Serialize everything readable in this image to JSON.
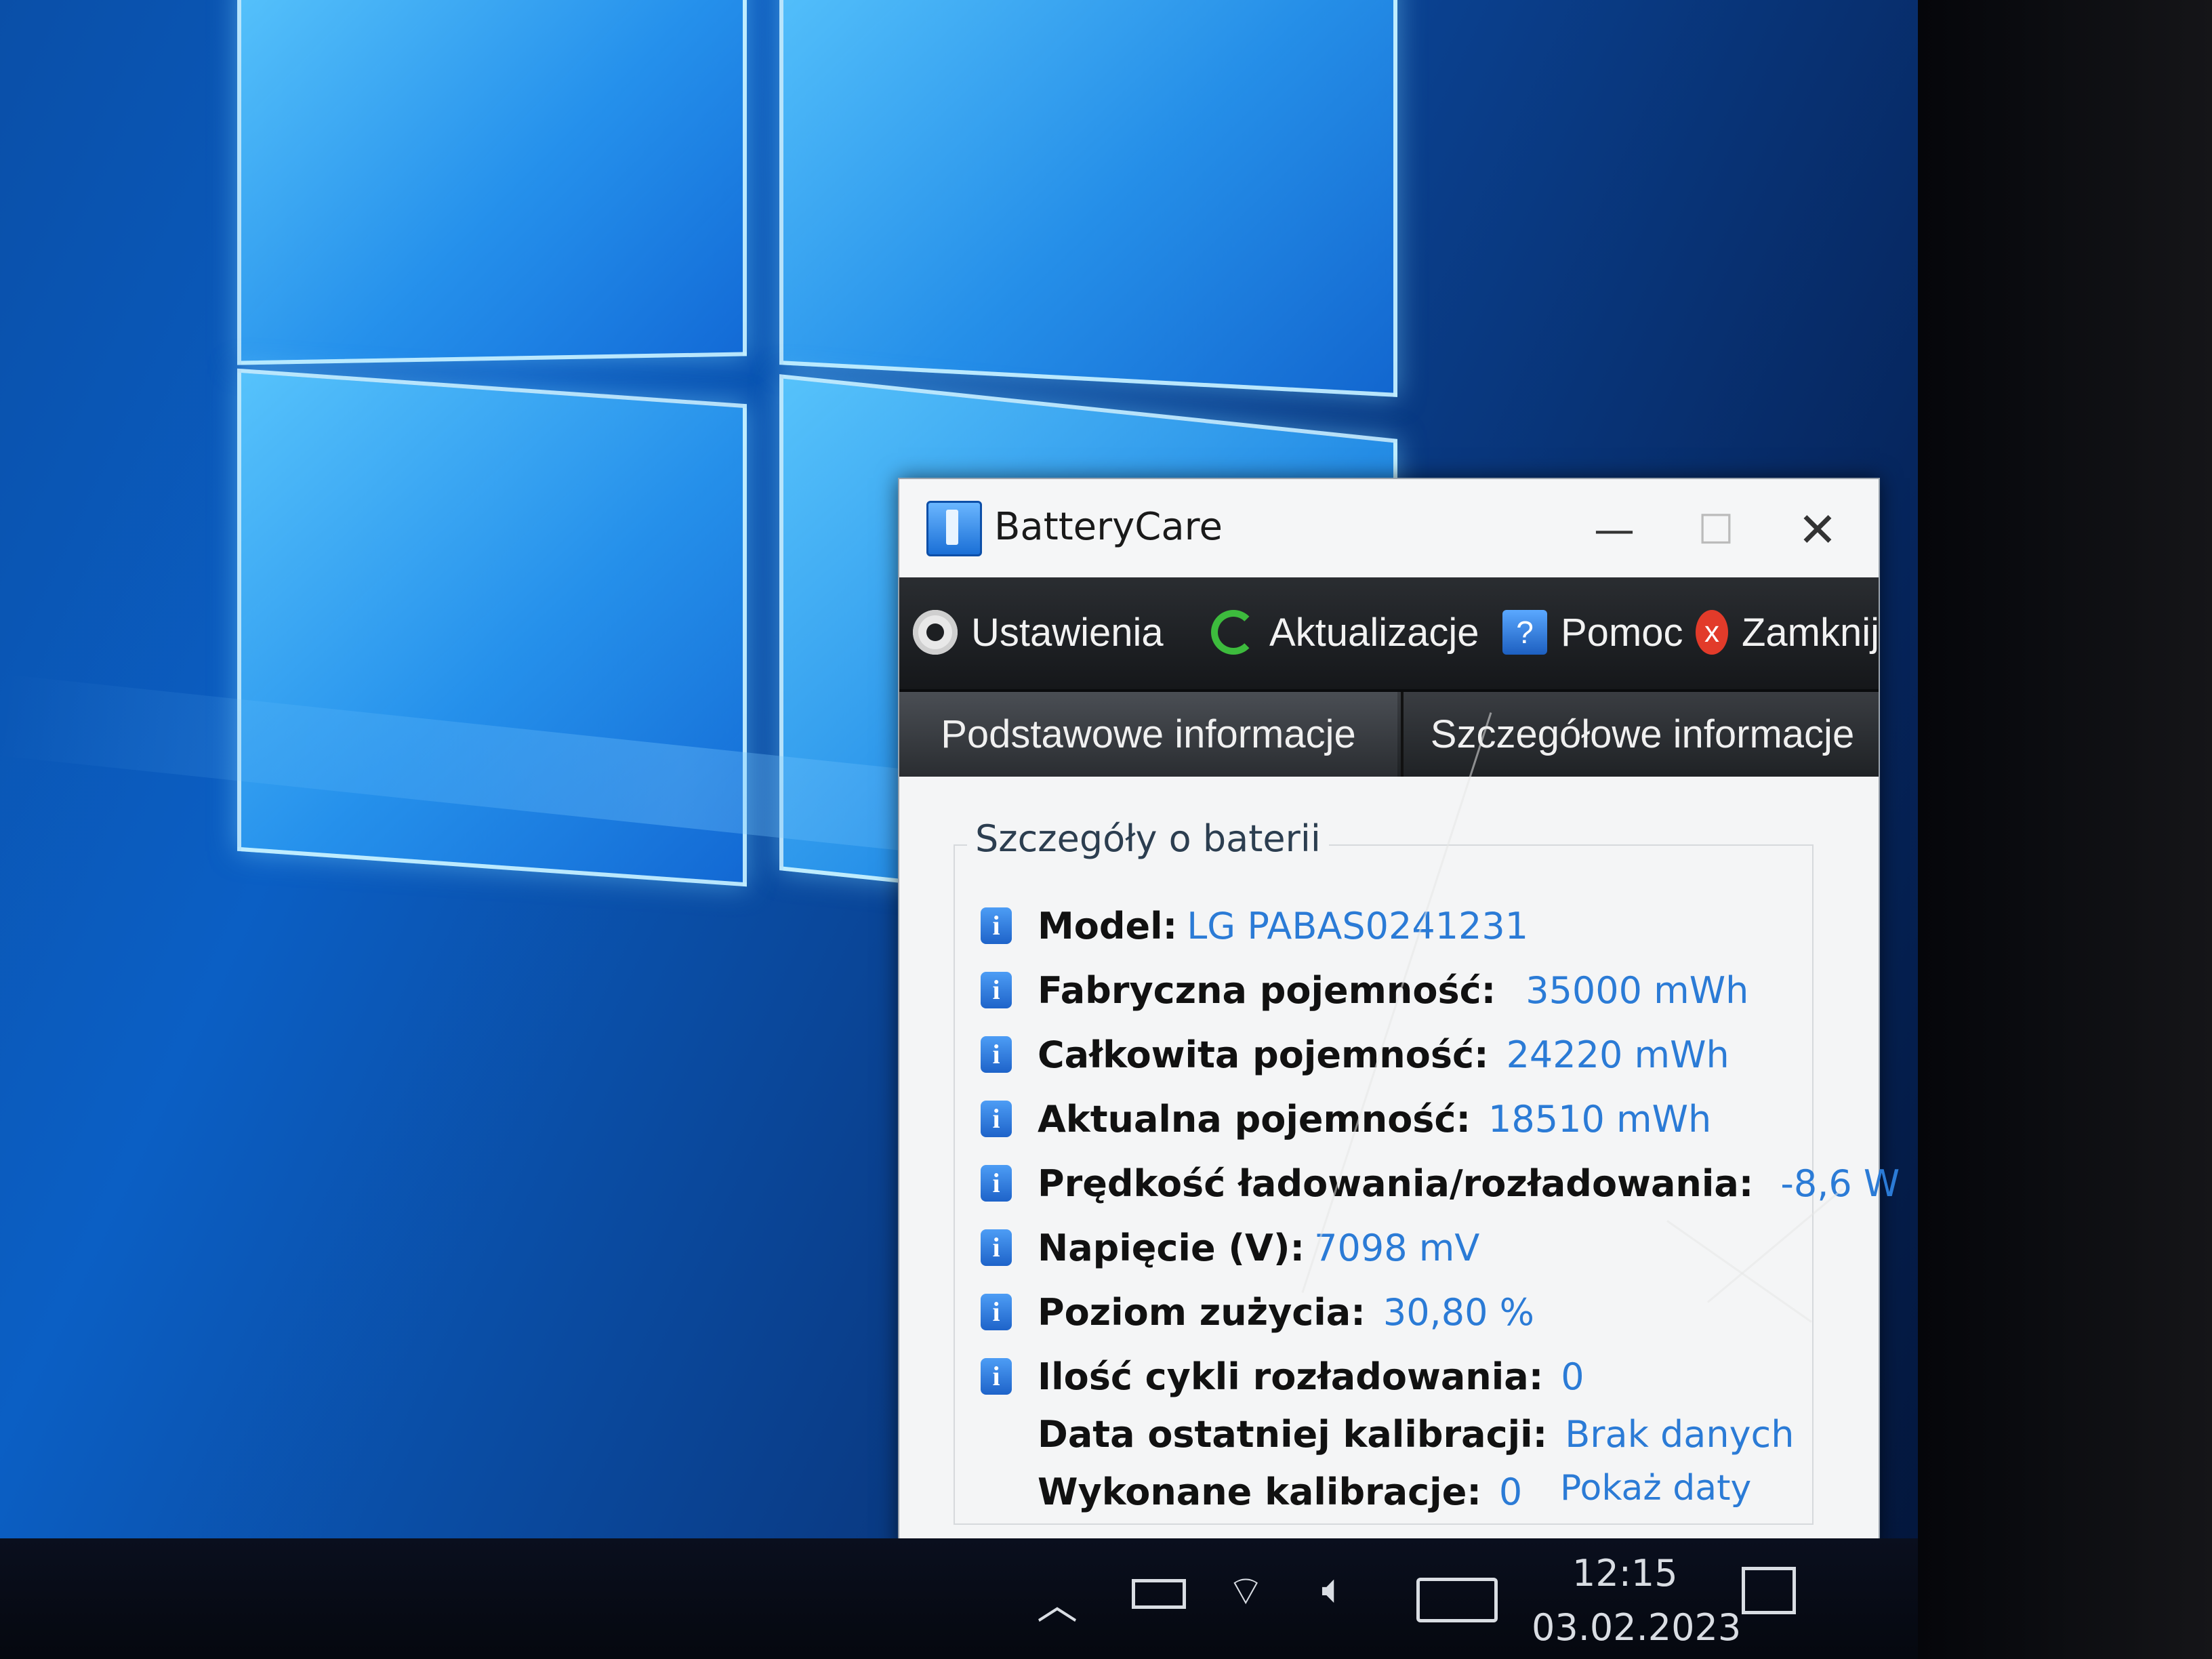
{
  "window": {
    "title": "BatteryCare",
    "controls": {
      "minimize": "—",
      "maximize": "☐",
      "close": "✕"
    }
  },
  "toolbar": {
    "settings_label": "Ustawienia",
    "updates_label": "Aktualizacje",
    "help_label": "Pomoc",
    "close_label": "Zamknij",
    "help_icon_glyph": "?",
    "close_icon_glyph": "x"
  },
  "tabs": {
    "basic": "Podstawowe informacje",
    "detailed": "Szczegółowe informacje",
    "active": "detailed"
  },
  "details": {
    "group_title": "Szczegóły o baterii",
    "info_glyph": "i",
    "model_label": "Model:",
    "model_value": "LG  PABAS0241231",
    "design_capacity_label": "Fabryczna pojemność:",
    "design_capacity_value": "35000 mWh",
    "full_capacity_label": "Całkowita pojemność:",
    "full_capacity_value": "24220 mWh",
    "current_capacity_label": "Aktualna pojemność:",
    "current_capacity_value": "18510 mWh",
    "rate_label": "Prędkość ładowania/rozładowania:",
    "rate_value": "-8,6 W",
    "voltage_label": "Napięcie (V):",
    "voltage_value": "7098 mV",
    "wear_label": "Poziom zużycia:",
    "wear_value": "30,80 %",
    "cycles_label": "Ilość cykli rozładowania:",
    "cycles_value": "0",
    "last_calibration_label": "Data ostatniej kalibracji:",
    "last_calibration_value": "Brak danych",
    "calibrations_label": "Wykonane kalibracje:",
    "calibrations_value": "0",
    "show_dates_link": "Pokaż daty"
  },
  "taskbar": {
    "time": "12:15",
    "date": "03.02.2023"
  },
  "colors": {
    "accent_value": "#2b7bd6",
    "toolbar_bg": "#1d1f22",
    "desktop_blue": "#0b5fc4"
  }
}
